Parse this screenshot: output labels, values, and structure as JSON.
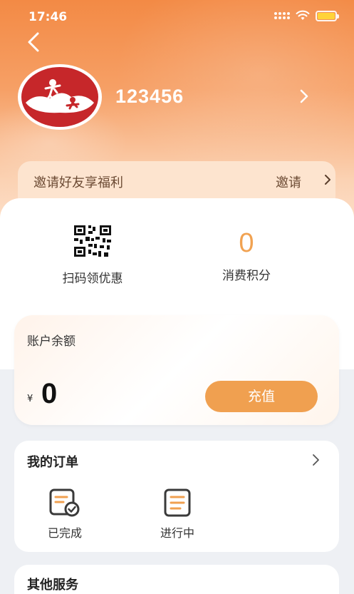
{
  "status_bar": {
    "time": "17:46"
  },
  "profile": {
    "username": "123456",
    "avatar": "ski-logo"
  },
  "invite": {
    "text": "邀请好友享福利",
    "action": "邀请"
  },
  "quick_actions": {
    "scan": {
      "label": "扫码领优惠",
      "icon": "qr-code-icon"
    },
    "points": {
      "value": "0",
      "label": "消费积分"
    }
  },
  "balance": {
    "title": "账户余额",
    "currency": "¥",
    "value": "0",
    "recharge_label": "充值"
  },
  "orders": {
    "title": "我的订单",
    "items": [
      {
        "label": "已完成",
        "icon": "order-completed-icon"
      },
      {
        "label": "进行中",
        "icon": "order-in-progress-icon"
      }
    ]
  },
  "services": {
    "title": "其他服务"
  },
  "colors": {
    "accent": "#f0a050",
    "header": "#f38a45",
    "points": "#f1a251",
    "logo_red": "#c6272a"
  }
}
